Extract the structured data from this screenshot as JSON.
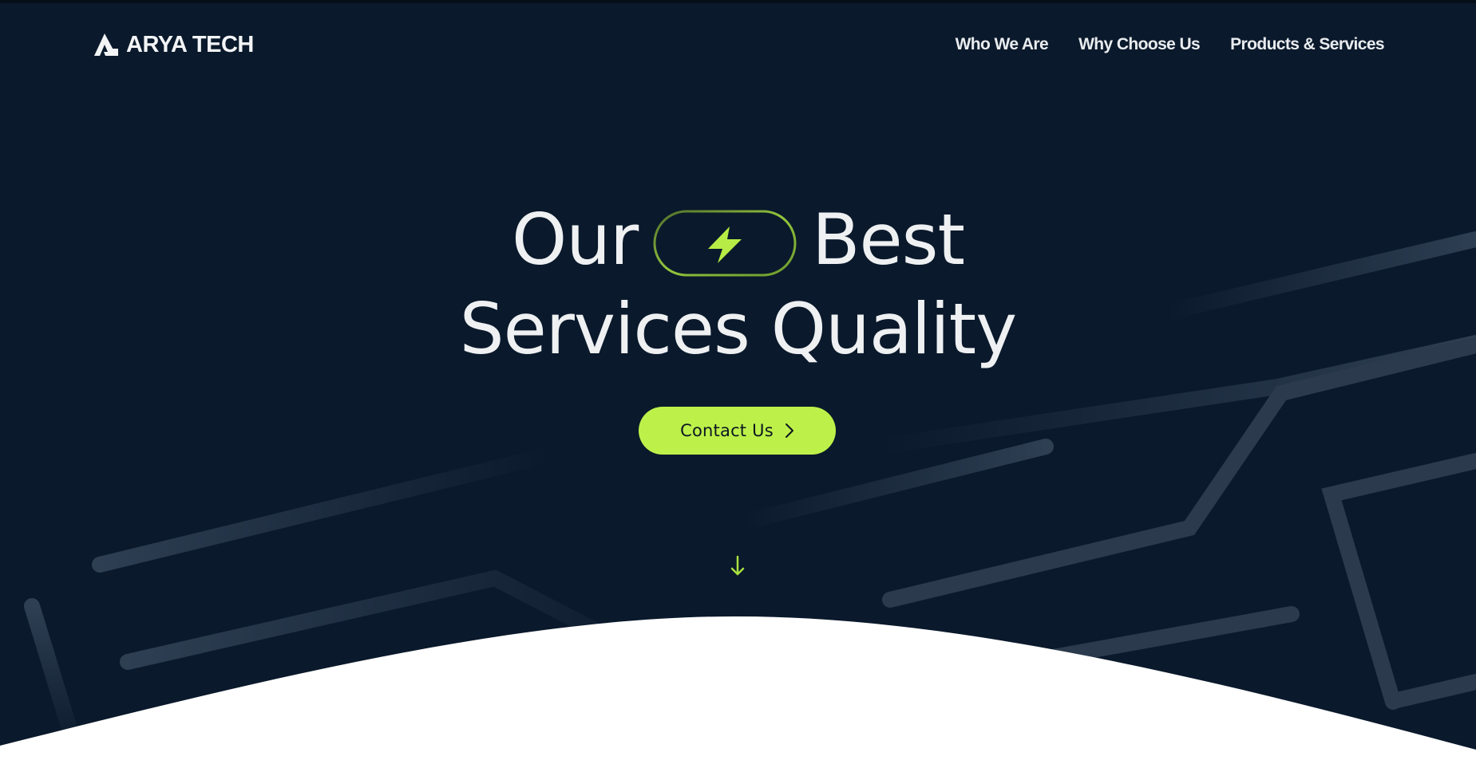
{
  "brand": {
    "name": "ARYA TECH",
    "logo_icon": "arya-a-logo-icon"
  },
  "nav": {
    "items": [
      {
        "label": "Who We Are"
      },
      {
        "label": "Why Choose Us"
      },
      {
        "label": "Products & Services"
      }
    ]
  },
  "hero": {
    "title_word_1": "Our",
    "title_word_2": "Best",
    "title_line_2": "Services Quality",
    "badge_icon": "lightning-bolt-icon",
    "cta_label": "Contact Us",
    "cta_icon": "chevron-right-icon",
    "scroll_icon": "arrow-down-icon"
  },
  "colors": {
    "background": "#0a192b",
    "accent": "#bdf14a",
    "text": "#eef0f2",
    "lines": "#2c3b4d",
    "wave": "#ffffff"
  }
}
